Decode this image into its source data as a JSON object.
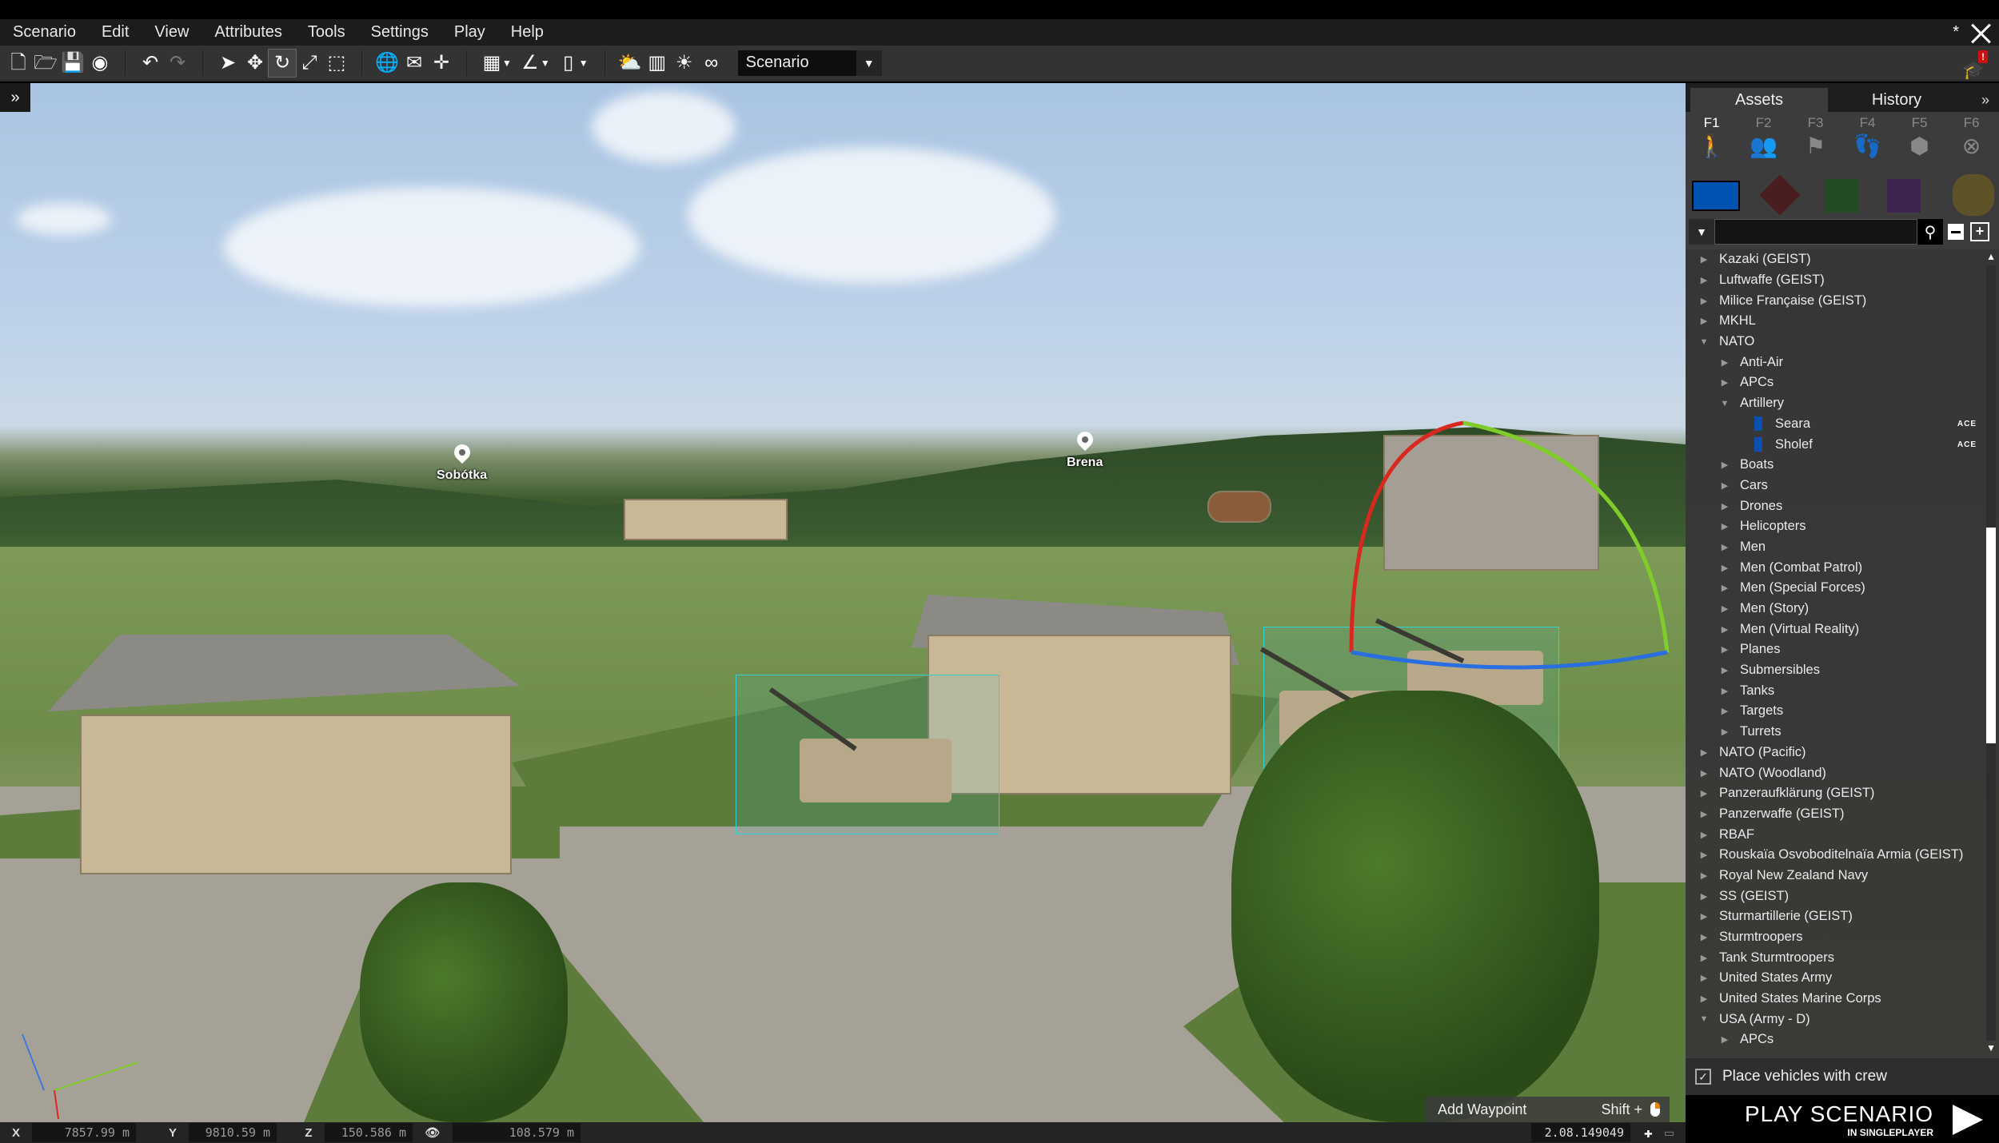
{
  "menubar": {
    "items": [
      "Scenario",
      "Edit",
      "View",
      "Attributes",
      "Tools",
      "Settings",
      "Play",
      "Help"
    ],
    "modified_indicator": "*"
  },
  "toolbar": {
    "groups": [
      [
        "new-file-icon",
        "open-folder-icon",
        "save-icon",
        "steam-icon"
      ],
      [
        "undo-icon",
        "redo-icon"
      ],
      [
        "select-icon",
        "move-icon",
        "rotate-icon",
        "scale-icon",
        "area-select-icon"
      ],
      [
        "globe-icon",
        "surface-snap-icon",
        "vertical-align-icon"
      ],
      [
        "grid-icon",
        "angle-icon",
        "ruler-icon"
      ],
      [
        "weather-icon",
        "map-icon",
        "lighting-icon",
        "binoculars-icon"
      ]
    ],
    "active_tool": "rotate-icon",
    "mode_select": {
      "value": "Scenario"
    }
  },
  "viewport": {
    "locations": [
      {
        "name": "Sobótka"
      },
      {
        "name": "Brena"
      }
    ],
    "axis_labels": {
      "x": "X",
      "y": "Y",
      "z": "Z"
    }
  },
  "hint": {
    "action": "Add Waypoint",
    "shortcut": "Shift +"
  },
  "statusbar": {
    "x_label": "X",
    "x_value": "7857.99 m",
    "y_label": "Y",
    "y_value": "9810.59 m",
    "z_label": "Z",
    "z_value": "150.586 m",
    "camera_distance": "108.579 m",
    "build_version": "2.08.149049"
  },
  "panel": {
    "tabs": [
      {
        "label": "Assets",
        "active": true
      },
      {
        "label": "History",
        "active": false
      }
    ],
    "more_label": "»",
    "categories": [
      {
        "key": "F1",
        "icon": "unit-icon",
        "active": true
      },
      {
        "key": "F2",
        "icon": "group-icon",
        "active": false
      },
      {
        "key": "F3",
        "icon": "flag-icon",
        "active": false
      },
      {
        "key": "F4",
        "icon": "footsteps-icon",
        "active": false
      },
      {
        "key": "F5",
        "icon": "boxes-icon",
        "active": false
      },
      {
        "key": "F6",
        "icon": "empty-marker-icon",
        "active": false
      }
    ],
    "sides": [
      {
        "name": "BLUFOR",
        "color": "#0052b0",
        "selected": true
      },
      {
        "name": "OPFOR",
        "color": "#4a1e1e",
        "selected": false
      },
      {
        "name": "Independent",
        "color": "#234a23",
        "selected": false
      },
      {
        "name": "Civilian",
        "color": "#3e2450",
        "selected": false
      },
      {
        "name": "Empty",
        "color": "#5e5328",
        "selected": false
      }
    ],
    "search": {
      "value": "",
      "placeholder": ""
    },
    "tree": [
      {
        "level": 0,
        "expanded": false,
        "label": "Kazaki (GEIST)"
      },
      {
        "level": 0,
        "expanded": false,
        "label": "Luftwaffe (GEIST)"
      },
      {
        "level": 0,
        "expanded": false,
        "label": "Milice Française (GEIST)"
      },
      {
        "level": 0,
        "expanded": false,
        "label": "MKHL"
      },
      {
        "level": 0,
        "expanded": true,
        "label": "NATO"
      },
      {
        "level": 1,
        "expanded": false,
        "label": "Anti-Air"
      },
      {
        "level": 1,
        "expanded": false,
        "label": "APCs"
      },
      {
        "level": 1,
        "expanded": true,
        "label": "Artillery"
      },
      {
        "level": 2,
        "leaf": true,
        "label": "Seara",
        "tag": "ACE"
      },
      {
        "level": 2,
        "leaf": true,
        "label": "Sholef",
        "tag": "ACE"
      },
      {
        "level": 1,
        "expanded": false,
        "label": "Boats"
      },
      {
        "level": 1,
        "expanded": false,
        "label": "Cars"
      },
      {
        "level": 1,
        "expanded": false,
        "label": "Drones"
      },
      {
        "level": 1,
        "expanded": false,
        "label": "Helicopters"
      },
      {
        "level": 1,
        "expanded": false,
        "label": "Men"
      },
      {
        "level": 1,
        "expanded": false,
        "label": "Men (Combat Patrol)"
      },
      {
        "level": 1,
        "expanded": false,
        "label": "Men (Special Forces)"
      },
      {
        "level": 1,
        "expanded": false,
        "label": "Men (Story)"
      },
      {
        "level": 1,
        "expanded": false,
        "label": "Men (Virtual Reality)"
      },
      {
        "level": 1,
        "expanded": false,
        "label": "Planes"
      },
      {
        "level": 1,
        "expanded": false,
        "label": "Submersibles"
      },
      {
        "level": 1,
        "expanded": false,
        "label": "Tanks"
      },
      {
        "level": 1,
        "expanded": false,
        "label": "Targets"
      },
      {
        "level": 1,
        "expanded": false,
        "label": "Turrets"
      },
      {
        "level": 0,
        "expanded": false,
        "label": "NATO (Pacific)"
      },
      {
        "level": 0,
        "expanded": false,
        "label": "NATO (Woodland)"
      },
      {
        "level": 0,
        "expanded": false,
        "label": "Panzeraufklärung (GEIST)"
      },
      {
        "level": 0,
        "expanded": false,
        "label": "Panzerwaffe (GEIST)"
      },
      {
        "level": 0,
        "expanded": false,
        "label": "RBAF"
      },
      {
        "level": 0,
        "expanded": false,
        "label": "Rouskaïa Osvoboditelnaïa Armia (GEIST)"
      },
      {
        "level": 0,
        "expanded": false,
        "label": "Royal New Zealand Navy"
      },
      {
        "level": 0,
        "expanded": false,
        "label": "SS (GEIST)"
      },
      {
        "level": 0,
        "expanded": false,
        "label": "Sturmartillerie (GEIST)"
      },
      {
        "level": 0,
        "expanded": false,
        "label": "Sturmtroopers"
      },
      {
        "level": 0,
        "expanded": false,
        "label": "Tank Sturmtroopers"
      },
      {
        "level": 0,
        "expanded": false,
        "label": "United States Army"
      },
      {
        "level": 0,
        "expanded": false,
        "label": "United States Marine Corps"
      },
      {
        "level": 0,
        "expanded": true,
        "label": "USA (Army - D)"
      },
      {
        "level": 1,
        "expanded": false,
        "label": "APCs"
      }
    ],
    "place_with_crew": {
      "label": "Place vehicles with crew",
      "checked": true
    },
    "play": {
      "title": "PLAY SCENARIO",
      "subtitle": "IN SINGLEPLAYER"
    }
  }
}
